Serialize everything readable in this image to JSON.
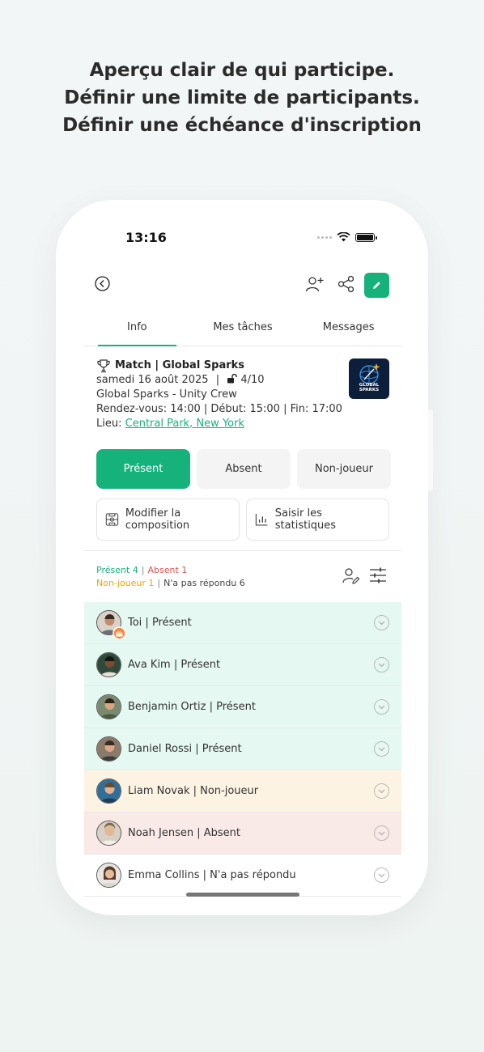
{
  "headline": {
    "line1": "Aperçu clair de qui participe.",
    "line2": "Définir une limite de participants.",
    "line3": "Définir une échéance d'inscription"
  },
  "status_bar": {
    "time": "13:16"
  },
  "tabs": [
    {
      "label": "Info",
      "active": true
    },
    {
      "label": "Mes tâches",
      "active": false
    },
    {
      "label": "Messages",
      "active": false
    }
  ],
  "event": {
    "title": "Match | Global Sparks",
    "date": "samedi 16 août 2025",
    "capacity": "4/10",
    "teams": "Global Sparks - Unity Crew",
    "times": "Rendez-vous: 14:00 | Début: 15:00 | Fin: 17:00",
    "location_label": "Lieu:",
    "location_link": "Central Park, New York",
    "logo_text_1": "GLOBAL",
    "logo_text_2": "SPARKS"
  },
  "attendance_buttons": {
    "present": "Présent",
    "absent": "Absent",
    "non_player": "Non-joueur"
  },
  "actions": {
    "composition": "Modifier la composition",
    "statistics": "Saisir les statistiques"
  },
  "summary": {
    "present": "Présent 4",
    "absent": "Absent 1",
    "non_player": "Non-joueur 1",
    "no_reply": "N'a pas répondu 6"
  },
  "participants": [
    {
      "label": "Toi | Présent",
      "status": "present"
    },
    {
      "label": "Ava Kim | Présent",
      "status": "present"
    },
    {
      "label": "Benjamin Ortiz | Présent",
      "status": "present"
    },
    {
      "label": "Daniel Rossi | Présent",
      "status": "present"
    },
    {
      "label": "Liam Novak | Non-joueur",
      "status": "nonp"
    },
    {
      "label": "Noah Jensen | Absent",
      "status": "absent"
    },
    {
      "label": "Emma Collins | N'a pas répondu",
      "status": "none"
    }
  ],
  "colors": {
    "accent": "#15b27c",
    "absent": "#d9534f",
    "non_player": "#f0a500"
  }
}
